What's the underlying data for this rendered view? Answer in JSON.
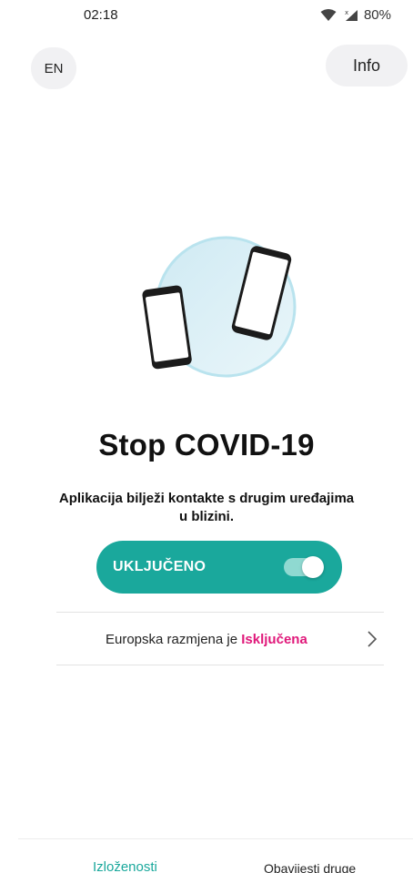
{
  "status_bar": {
    "time": "02:18",
    "battery": "80%"
  },
  "header": {
    "language_button": "EN",
    "info_button": "Info"
  },
  "main": {
    "title": "Stop COVID-19",
    "subtitle": "Aplikacija bilježi kontakte s drugim uređajima u blizini.",
    "toggle": {
      "label": "UKLJUČENO",
      "state": "on"
    },
    "exchange": {
      "text": "Europska razmjena je ",
      "status": "Isključena"
    }
  },
  "bottom_nav": {
    "tabs": [
      {
        "label": "Izloženosti",
        "active": true
      },
      {
        "label": "Obavijesti druge",
        "active": false
      }
    ]
  },
  "colors": {
    "accent": "#1aa89c",
    "status_off": "#e0187a",
    "circle": "#d5eef5"
  }
}
